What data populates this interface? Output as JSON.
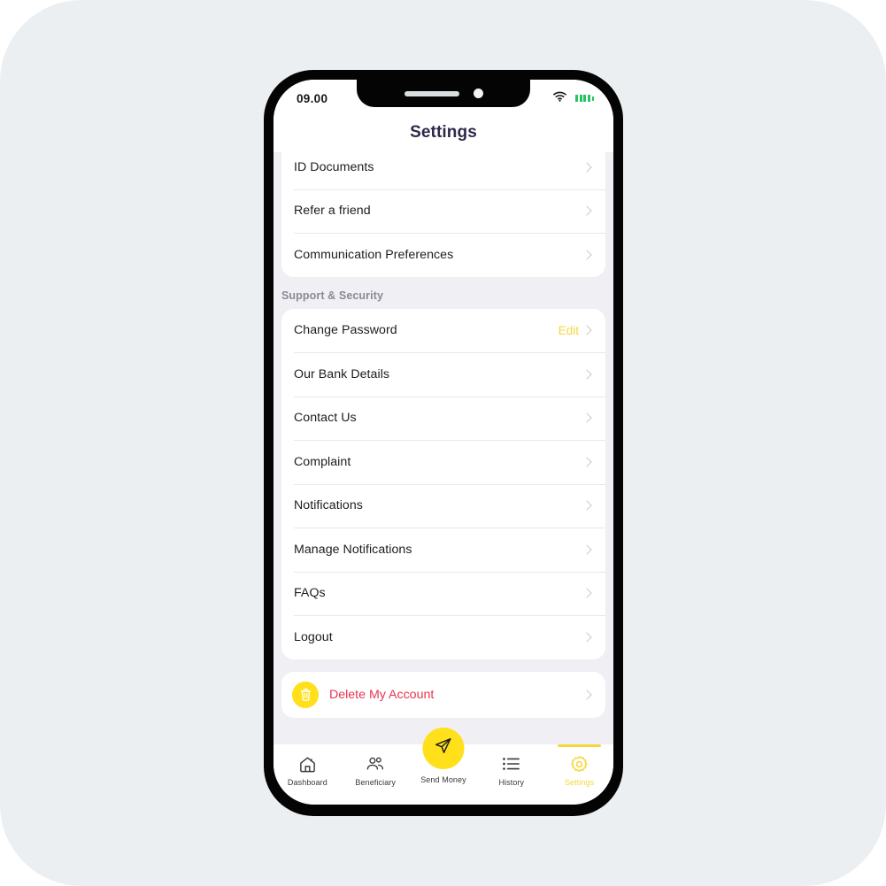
{
  "status_bar": {
    "time": "09.00",
    "wifi_icon": "wifi-icon",
    "battery_icon": "battery-icon",
    "battery_color": "#22C55E"
  },
  "header": {
    "title": "Settings",
    "title_color": "#2E2A4A"
  },
  "theme": {
    "accent": "#FFE01B",
    "accent_text": "#F5D73C",
    "danger": "#E8344E",
    "page_background": "#ECEFF1",
    "list_background": "#EFEFF4"
  },
  "sections": [
    {
      "id": "account",
      "header": null,
      "clipped_top": true,
      "rows": [
        {
          "label": "ID Documents",
          "action": null
        },
        {
          "label": "Refer a friend",
          "action": null
        },
        {
          "label": "Communication Preferences",
          "action": null
        }
      ]
    },
    {
      "id": "support-security",
      "header": "Support & Security",
      "clipped_top": false,
      "rows": [
        {
          "label": "Change Password",
          "action": "Edit"
        },
        {
          "label": "Our Bank Details",
          "action": null
        },
        {
          "label": "Contact Us",
          "action": null
        },
        {
          "label": "Complaint",
          "action": null
        },
        {
          "label": "Notifications",
          "action": null
        },
        {
          "label": "Manage Notifications",
          "action": null
        },
        {
          "label": "FAQs",
          "action": null
        },
        {
          "label": "Logout",
          "action": null
        }
      ]
    }
  ],
  "delete_account": {
    "label": "Delete My Account",
    "icon": "trash-icon"
  },
  "tabbar": {
    "items": [
      {
        "label": "Dashboard",
        "icon": "home-icon",
        "active": false
      },
      {
        "label": "Beneficiary",
        "icon": "people-icon",
        "active": false
      },
      {
        "label": "Send Money",
        "icon": "paper-plane-icon",
        "active": false,
        "center": true
      },
      {
        "label": "History",
        "icon": "list-icon",
        "active": false
      },
      {
        "label": "Settings",
        "icon": "gear-icon",
        "active": true
      }
    ]
  }
}
